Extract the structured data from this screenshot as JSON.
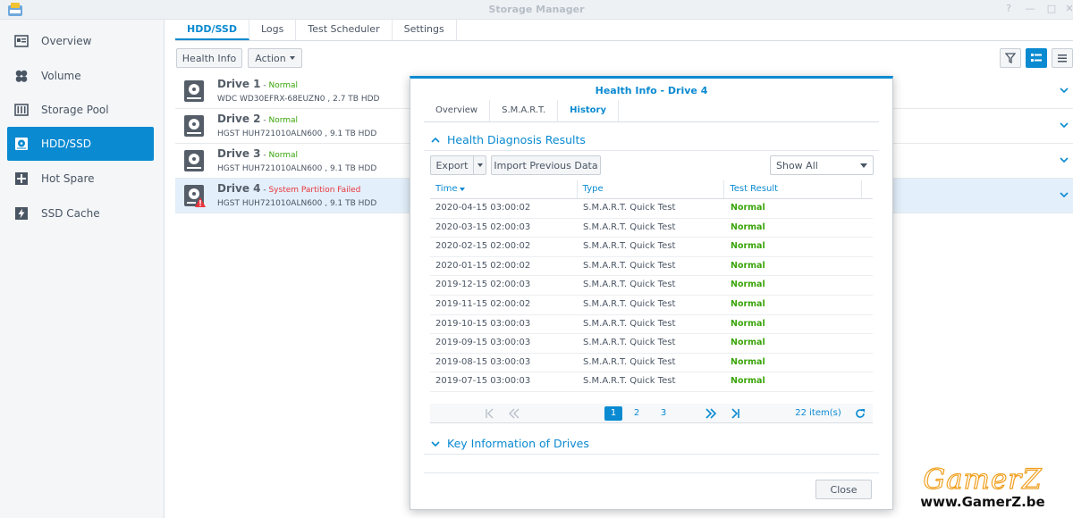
{
  "window": {
    "title": "Storage Manager",
    "controls": [
      "?",
      "—",
      "□",
      "✕"
    ]
  },
  "sidebar": {
    "items": [
      {
        "label": "Overview",
        "icon": "overview-icon"
      },
      {
        "label": "Volume",
        "icon": "volume-icon"
      },
      {
        "label": "Storage Pool",
        "icon": "storage-pool-icon"
      },
      {
        "label": "HDD/SSD",
        "icon": "hdd-icon",
        "active": true
      },
      {
        "label": "Hot Spare",
        "icon": "hot-spare-icon"
      },
      {
        "label": "SSD Cache",
        "icon": "ssd-cache-icon"
      }
    ]
  },
  "main": {
    "tabs": [
      "HDD/SSD",
      "Logs",
      "Test Scheduler",
      "Settings"
    ],
    "toolbar": {
      "health_info": "Health Info",
      "action": "Action"
    },
    "drives": [
      {
        "name": "Drive 1",
        "sep": " - ",
        "status": "Normal",
        "status_type": "ok",
        "model": "WDC WD30EFRX-68EUZN0 , 2.7 TB HDD"
      },
      {
        "name": "Drive 2",
        "sep": " - ",
        "status": "Normal",
        "status_type": "ok",
        "model": "HGST HUH721010ALN600 , 9.1 TB HDD"
      },
      {
        "name": "Drive 3",
        "sep": " - ",
        "status": "Normal",
        "status_type": "ok",
        "model": "HGST HUH721010ALN600 , 9.1 TB HDD"
      },
      {
        "name": "Drive 4",
        "sep": " - ",
        "status": "System Partition Failed",
        "status_type": "bad",
        "model": "HGST HUH721010ALN600 , 9.1 TB HDD"
      }
    ]
  },
  "dialog": {
    "title": "Health Info - Drive 4",
    "tabs": [
      "Overview",
      "S.M.A.R.T.",
      "History"
    ],
    "section1": "Health Diagnosis Results",
    "export": "Export",
    "import": "Import Previous Data",
    "filter": "Show All",
    "columns": [
      "Time",
      "Type",
      "Test Result"
    ],
    "rows": [
      [
        "2020-04-15 03:00:02",
        "S.M.A.R.T. Quick Test",
        "Normal"
      ],
      [
        "2020-03-15 02:00:03",
        "S.M.A.R.T. Quick Test",
        "Normal"
      ],
      [
        "2020-02-15 02:00:02",
        "S.M.A.R.T. Quick Test",
        "Normal"
      ],
      [
        "2020-01-15 02:00:02",
        "S.M.A.R.T. Quick Test",
        "Normal"
      ],
      [
        "2019-12-15 02:00:03",
        "S.M.A.R.T. Quick Test",
        "Normal"
      ],
      [
        "2019-11-15 02:00:02",
        "S.M.A.R.T. Quick Test",
        "Normal"
      ],
      [
        "2019-10-15 03:00:03",
        "S.M.A.R.T. Quick Test",
        "Normal"
      ],
      [
        "2019-09-15 03:00:03",
        "S.M.A.R.T. Quick Test",
        "Normal"
      ],
      [
        "2019-08-15 03:00:03",
        "S.M.A.R.T. Quick Test",
        "Normal"
      ],
      [
        "2019-07-15 03:00:03",
        "S.M.A.R.T. Quick Test",
        "Normal"
      ]
    ],
    "pager": {
      "pages": [
        "1",
        "2",
        "3"
      ],
      "current": "1",
      "count": "22 item(s)"
    },
    "section2": "Key Information of Drives",
    "close": "Close"
  },
  "watermark": {
    "logo": "GamerZ",
    "url": "www.GamerZ.be"
  },
  "colors": {
    "accent": "#0a8ad1",
    "ok": "#3aa50a",
    "error": "#e8363c"
  }
}
